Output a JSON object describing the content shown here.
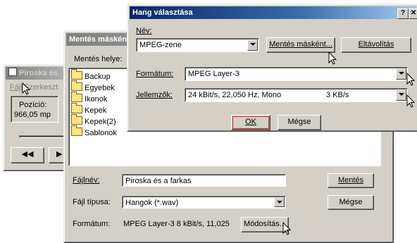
{
  "player": {
    "title": "Piroska és",
    "menu": [
      "Fájl",
      "Szerkeszt"
    ],
    "position_label": "Pozíció:",
    "position_value": "966,05 mp",
    "rewind_glyph": "◀◀",
    "play_glyph": "▶"
  },
  "save": {
    "title": "Mentés máskén",
    "location_label": "Mentés helye:",
    "folders": [
      "Backup",
      "Egyebek",
      "Ikonok",
      "Kepek",
      "Kepek(2)",
      "Sablonok"
    ],
    "filename_label": "Fájlnév:",
    "filename_value": "Piroska és a farkas",
    "save_button": "Mentés",
    "filetype_label": "Fájl típusa:",
    "filetype_value": "Hangok (*.wav)",
    "cancel_button": "Mégse",
    "format_label": "Formátum:",
    "format_value": "MPEG Layer-3 8 kBit/s, 11,025",
    "modify_button": "Módosítás..."
  },
  "sound": {
    "title": "Hang választása",
    "help_glyph": "?",
    "close_glyph": "✕",
    "name_label": "Név:",
    "name_value": "MPEG-zene",
    "save_as_button": "Mentés másként...",
    "remove_button": "Eltávolítás",
    "format_label": "Formátum:",
    "format_value": "MPEG Layer-3",
    "attributes_label": "Jellemzők:",
    "attributes_value": "24 kBit/s, 22,050 Hz, Mono",
    "attributes_rate": "3 KB/s",
    "ok_button": "OK",
    "cancel_button": "Mégse"
  },
  "colors": {
    "title_active": "#0a246a",
    "title_inactive": "#808080",
    "face": "#d4d0c8",
    "ok_focus": "#e02020"
  }
}
